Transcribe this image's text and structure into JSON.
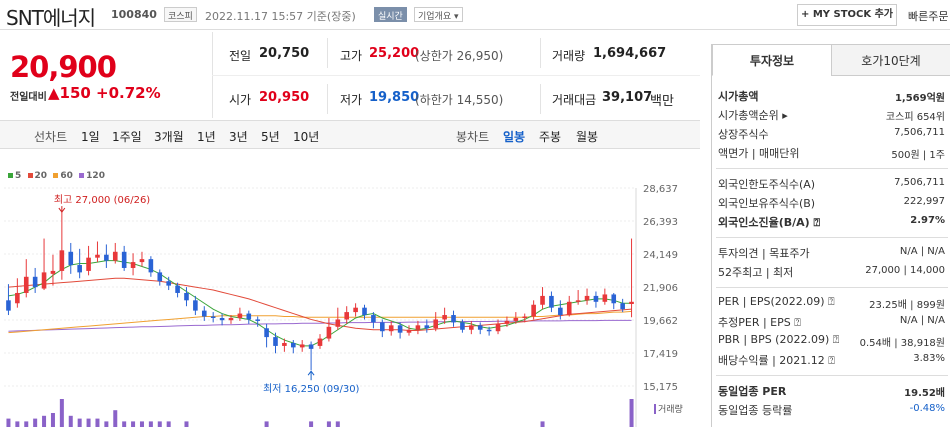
{
  "header": {
    "stock_name": "SNT에너지",
    "code": "100840",
    "market_tag": "코스피",
    "datetime": "2022.11.17 15:57 기준(장중)",
    "live_tag": "실시간",
    "company_tag": "기업개요",
    "company_tag_arrow": "▾",
    "mystock_label": "+ MY STOCK 추가",
    "quick_order": "빠른주문"
  },
  "quote": {
    "price": "20,900",
    "diff_label": "전일대비",
    "diff_arrow": "▲",
    "diff_amount": "150",
    "diff_pct": "+0.72%",
    "prev_label": "전일",
    "prev_val": "20,750",
    "high_label": "고가",
    "high_val": "25,200",
    "upper_limit": "(상한가 26,950)",
    "volume_label": "거래량",
    "volume_val": "1,694,667",
    "open_label": "시가",
    "open_val": "20,950",
    "low_label": "저가",
    "low_val": "19,850",
    "lower_limit": "(하한가 14,550)",
    "amount_label": "거래대금",
    "amount_val": "39,107",
    "amount_unit": "백만"
  },
  "periods": {
    "line_label": "선차트",
    "items": [
      "1일",
      "1주일",
      "3개월",
      "1년",
      "3년",
      "5년",
      "10년"
    ],
    "candle_label": "봉차트",
    "candle_items": [
      "일봉",
      "주봉",
      "월봉"
    ],
    "active_candle": "일봉"
  },
  "chart": {
    "legend": [
      {
        "name": "5",
        "color": "#3aa53a"
      },
      {
        "name": "20",
        "color": "#e24a3a"
      },
      {
        "name": "60",
        "color": "#f0a030"
      },
      {
        "name": "120",
        "color": "#9a6ad0"
      }
    ],
    "high_note": "최고 27,000 (06/26)",
    "low_note": "최저 16,250 (09/30)",
    "ticks": [
      "28,637",
      "26,393",
      "24,149",
      "21,906",
      "19,662",
      "17,419",
      "15,175"
    ],
    "volume_label": "거래량",
    "colors": {
      "up": "#e8383a",
      "down": "#2a63d5",
      "ma5": "#3aa53a",
      "ma20": "#e24a3a",
      "ma60": "#f0a030",
      "ma120": "#9a6ad0",
      "volume": "#8a62c8"
    }
  },
  "chart_data": {
    "type": "candlestick",
    "y_ticks": [
      28637,
      26393,
      24149,
      21906,
      19662,
      17419,
      15175
    ],
    "ylim": [
      15175,
      28637
    ],
    "candles": [
      {
        "o": 21000,
        "c": 20300,
        "h": 22100,
        "l": 20000
      },
      {
        "o": 20800,
        "c": 21500,
        "h": 22500,
        "l": 20500
      },
      {
        "o": 21500,
        "c": 22600,
        "h": 23800,
        "l": 21200
      },
      {
        "o": 22600,
        "c": 21900,
        "h": 23200,
        "l": 21500
      },
      {
        "o": 21800,
        "c": 22900,
        "h": 25200,
        "l": 21700
      },
      {
        "o": 22800,
        "c": 23000,
        "h": 24100,
        "l": 22000
      },
      {
        "o": 23000,
        "c": 24400,
        "h": 27000,
        "l": 22400
      },
      {
        "o": 24300,
        "c": 23400,
        "h": 24900,
        "l": 22800
      },
      {
        "o": 23400,
        "c": 22900,
        "h": 24500,
        "l": 22500
      },
      {
        "o": 23000,
        "c": 23900,
        "h": 24700,
        "l": 22700
      },
      {
        "o": 23900,
        "c": 24100,
        "h": 25000,
        "l": 23600
      },
      {
        "o": 24100,
        "c": 23700,
        "h": 24800,
        "l": 23200
      },
      {
        "o": 23700,
        "c": 24300,
        "h": 24900,
        "l": 23500
      },
      {
        "o": 24300,
        "c": 23200,
        "h": 24700,
        "l": 23000
      },
      {
        "o": 23200,
        "c": 23600,
        "h": 24200,
        "l": 22700
      },
      {
        "o": 23600,
        "c": 23800,
        "h": 24300,
        "l": 23300
      },
      {
        "o": 23800,
        "c": 22900,
        "h": 24000,
        "l": 22600
      },
      {
        "o": 22900,
        "c": 22300,
        "h": 23100,
        "l": 22000
      },
      {
        "o": 22300,
        "c": 22000,
        "h": 22600,
        "l": 21700
      },
      {
        "o": 22000,
        "c": 21500,
        "h": 22200,
        "l": 21200
      },
      {
        "o": 21500,
        "c": 21000,
        "h": 21900,
        "l": 20600
      },
      {
        "o": 21000,
        "c": 20300,
        "h": 21300,
        "l": 20000
      },
      {
        "o": 20300,
        "c": 19900,
        "h": 20600,
        "l": 19600
      },
      {
        "o": 19900,
        "c": 19800,
        "h": 20200,
        "l": 19500
      },
      {
        "o": 19800,
        "c": 19650,
        "h": 20100,
        "l": 19300
      },
      {
        "o": 19650,
        "c": 19800,
        "h": 20000,
        "l": 19400
      },
      {
        "o": 19800,
        "c": 20100,
        "h": 20500,
        "l": 19600
      },
      {
        "o": 20100,
        "c": 19700,
        "h": 20300,
        "l": 19400
      },
      {
        "o": 19700,
        "c": 19600,
        "h": 19900,
        "l": 19200
      },
      {
        "o": 19100,
        "c": 18500,
        "h": 19400,
        "l": 17800
      },
      {
        "o": 18500,
        "c": 17900,
        "h": 18800,
        "l": 17400
      },
      {
        "o": 17900,
        "c": 18100,
        "h": 18400,
        "l": 17500
      },
      {
        "o": 18100,
        "c": 17800,
        "h": 18300,
        "l": 17400
      },
      {
        "o": 17800,
        "c": 18000,
        "h": 18300,
        "l": 17500
      },
      {
        "o": 18000,
        "c": 17700,
        "h": 18200,
        "l": 16250
      },
      {
        "o": 17900,
        "c": 18400,
        "h": 18700,
        "l": 17700
      },
      {
        "o": 18400,
        "c": 19200,
        "h": 19800,
        "l": 18200
      },
      {
        "o": 19200,
        "c": 19700,
        "h": 20500,
        "l": 19000
      },
      {
        "o": 19700,
        "c": 20200,
        "h": 20600,
        "l": 19400
      },
      {
        "o": 20200,
        "c": 20500,
        "h": 20800,
        "l": 19900
      },
      {
        "o": 20500,
        "c": 20000,
        "h": 20700,
        "l": 19700
      },
      {
        "o": 20000,
        "c": 19500,
        "h": 20200,
        "l": 19100
      },
      {
        "o": 19500,
        "c": 18900,
        "h": 19700,
        "l": 18500
      },
      {
        "o": 18900,
        "c": 19300,
        "h": 19600,
        "l": 18600
      },
      {
        "o": 19300,
        "c": 18800,
        "h": 19500,
        "l": 18400
      },
      {
        "o": 18800,
        "c": 19000,
        "h": 19300,
        "l": 18600
      },
      {
        "o": 19000,
        "c": 19300,
        "h": 19600,
        "l": 18700
      },
      {
        "o": 19300,
        "c": 19100,
        "h": 19700,
        "l": 18800
      },
      {
        "o": 19100,
        "c": 19700,
        "h": 20200,
        "l": 18900
      },
      {
        "o": 19700,
        "c": 20000,
        "h": 20500,
        "l": 19400
      },
      {
        "o": 20000,
        "c": 19500,
        "h": 20300,
        "l": 19200
      },
      {
        "o": 19500,
        "c": 19000,
        "h": 19700,
        "l": 18800
      },
      {
        "o": 19000,
        "c": 19300,
        "h": 19600,
        "l": 18700
      },
      {
        "o": 19300,
        "c": 19000,
        "h": 19500,
        "l": 18700
      },
      {
        "o": 19000,
        "c": 18900,
        "h": 19200,
        "l": 18600
      },
      {
        "o": 18900,
        "c": 19400,
        "h": 19700,
        "l": 18700
      },
      {
        "o": 19400,
        "c": 19600,
        "h": 19900,
        "l": 19200
      },
      {
        "o": 19600,
        "c": 19800,
        "h": 20200,
        "l": 19400
      },
      {
        "o": 19800,
        "c": 19900,
        "h": 20100,
        "l": 19500
      },
      {
        "o": 19900,
        "c": 20700,
        "h": 21000,
        "l": 19700
      },
      {
        "o": 20700,
        "c": 21300,
        "h": 21900,
        "l": 20400
      },
      {
        "o": 21300,
        "c": 20500,
        "h": 21600,
        "l": 20200
      },
      {
        "o": 20500,
        "c": 20000,
        "h": 21000,
        "l": 19700
      },
      {
        "o": 20000,
        "c": 20900,
        "h": 21300,
        "l": 19900
      },
      {
        "o": 20900,
        "c": 21000,
        "h": 21700,
        "l": 20700
      },
      {
        "o": 21000,
        "c": 21300,
        "h": 21800,
        "l": 20700
      },
      {
        "o": 21300,
        "c": 20900,
        "h": 21600,
        "l": 20500
      },
      {
        "o": 20900,
        "c": 21400,
        "h": 21800,
        "l": 20700
      },
      {
        "o": 21400,
        "c": 20800,
        "h": 21500,
        "l": 20400
      },
      {
        "o": 20800,
        "c": 20400,
        "h": 21100,
        "l": 20200
      },
      {
        "o": 20750,
        "c": 20900,
        "h": 25200,
        "l": 19850
      }
    ],
    "ma5": [
      21300,
      21400,
      21600,
      21900,
      22200,
      22700,
      23100,
      23400,
      23500,
      23500,
      23600,
      23700,
      23700,
      23600,
      23500,
      23300,
      23100,
      22800,
      22400,
      22000,
      21600,
      21200,
      20800,
      20400,
      20100,
      19900,
      19800,
      19700,
      19400,
      19000,
      18600,
      18300,
      18100,
      17900,
      17900,
      18200,
      18600,
      19000,
      19400,
      19800,
      20000,
      20100,
      19800,
      19600,
      19400,
      19100,
      19000,
      19100,
      19300,
      19500,
      19600,
      19500,
      19400,
      19200,
      19100,
      19200,
      19300,
      19500,
      19700,
      20000,
      20400,
      20600,
      20700,
      20800,
      20900,
      21000,
      21100,
      21100,
      21000,
      20800,
      20800
    ],
    "ma20": [
      21900,
      21950,
      22000,
      22050,
      22100,
      22150,
      22200,
      22250,
      22300,
      22350,
      22400,
      22450,
      22500,
      22500,
      22450,
      22400,
      22350,
      22300,
      22200,
      22100,
      22000,
      21900,
      21800,
      21700,
      21550,
      21400,
      21250,
      21100,
      20900,
      20700,
      20500,
      20300,
      20100,
      19900,
      19700,
      19550,
      19400,
      19300,
      19200,
      19100,
      19050,
      19000,
      19000,
      19000,
      19000,
      18950,
      18950,
      19000,
      19050,
      19100,
      19150,
      19200,
      19250,
      19300,
      19350,
      19400,
      19450,
      19500,
      19550,
      19650,
      19750,
      19850,
      19950,
      20050,
      20100,
      20150,
      20200,
      20250,
      20300,
      20350,
      20400
    ],
    "ma60": [
      18800,
      18850,
      18900,
      18950,
      19000,
      19050,
      19100,
      19150,
      19200,
      19250,
      19300,
      19350,
      19400,
      19450,
      19500,
      19550,
      19600,
      19650,
      19700,
      19750,
      19800,
      19850,
      19900,
      19900,
      19950,
      19950,
      19950,
      19950,
      19950,
      19950,
      19950,
      19900,
      19900,
      19850,
      19850,
      19850,
      19850,
      19850,
      19850,
      19850,
      19850,
      19850,
      19850,
      19850,
      19850,
      19850,
      19850,
      19850,
      19850,
      19850,
      19850,
      19850,
      19850,
      19850,
      19850,
      19850,
      19850,
      19850,
      19850,
      19900,
      19900,
      19950,
      20000,
      20000,
      20050,
      20100,
      20100,
      20150,
      20200,
      20200,
      20250
    ],
    "ma120": [
      18900,
      18920,
      18940,
      18960,
      18980,
      19000,
      19020,
      19040,
      19060,
      19080,
      19100,
      19120,
      19140,
      19160,
      19180,
      19200,
      19200,
      19220,
      19240,
      19260,
      19280,
      19300,
      19300,
      19320,
      19340,
      19340,
      19360,
      19380,
      19380,
      19400,
      19400,
      19420,
      19420,
      19440,
      19440,
      19440,
      19460,
      19460,
      19480,
      19480,
      19480,
      19500,
      19500,
      19500,
      19500,
      19520,
      19520,
      19520,
      19540,
      19540,
      19540,
      19560,
      19560,
      19560,
      19560,
      19580,
      19580,
      19580,
      19580,
      19600,
      19600,
      19600,
      19600,
      19620,
      19620,
      19620,
      19620,
      19640,
      19640,
      19640,
      19640
    ],
    "volume": [
      0.3,
      0.2,
      0.2,
      0.3,
      0.4,
      0.5,
      1.0,
      0.4,
      0.3,
      0.3,
      0.3,
      0.2,
      0.6,
      0.2,
      0.2,
      0.2,
      0.2,
      0.2,
      0.2,
      0.1,
      0.2,
      0.1,
      0.1,
      0.1,
      0.1,
      0.1,
      0.1,
      0.1,
      0.1,
      0.2,
      0.1,
      0.1,
      0.1,
      0.1,
      0.2,
      0.1,
      0.2,
      0.2,
      0.1,
      0.1,
      0.1,
      0.1,
      0.1,
      0.1,
      0.1,
      0.1,
      0.1,
      0.1,
      0.1,
      0.1,
      0.1,
      0.1,
      0.1,
      0.1,
      0.1,
      0.1,
      0.1,
      0.1,
      0.1,
      0.1,
      0.2,
      0.1,
      0.1,
      0.1,
      0.1,
      0.1,
      0.1,
      0.1,
      0.1,
      0.1,
      1.0
    ]
  },
  "panel": {
    "tab_invest": "투자정보",
    "tab_orderbook": "호가10단계",
    "rows1": [
      {
        "label": "시가총액",
        "value": "1,569억원",
        "bold": true
      },
      {
        "label": "시가총액순위",
        "value": "코스피 654위",
        "arrow": true
      },
      {
        "label": "상장주식수",
        "value": "7,506,711"
      },
      {
        "label": "액면가 | 매매단위",
        "value": "500원 | 1주"
      }
    ],
    "rows2": [
      {
        "label": "외국인한도주식수(A)",
        "value": "7,506,711"
      },
      {
        "label": "외국인보유주식수(B)",
        "value": "222,997"
      },
      {
        "label": "외국인소진율(B/A)",
        "value": "2.97%",
        "bold": true,
        "help": true
      }
    ],
    "rows3": [
      {
        "label": "투자의견 | 목표주가",
        "value": "N/A | N/A"
      },
      {
        "label": "52주최고 | 최저",
        "value": "27,000 | 14,000"
      }
    ],
    "rows4": [
      {
        "label": "PER | EPS(2022.09)",
        "value": "23.25배 | 899원",
        "help": true
      },
      {
        "label": "추정PER | EPS",
        "value": "N/A | N/A",
        "help": true
      },
      {
        "label": "PBR | BPS (2022.09)",
        "value": "0.54배 | 38,918원",
        "help": true
      },
      {
        "label": "배당수익률 | 2021.12",
        "value": "3.83%",
        "help": true
      }
    ],
    "rows5": [
      {
        "label": "동일업종 PER",
        "value": "19.52배",
        "bold": true
      },
      {
        "label": "동일업종 등락률",
        "value": "-0.48%",
        "blue": true
      }
    ]
  }
}
